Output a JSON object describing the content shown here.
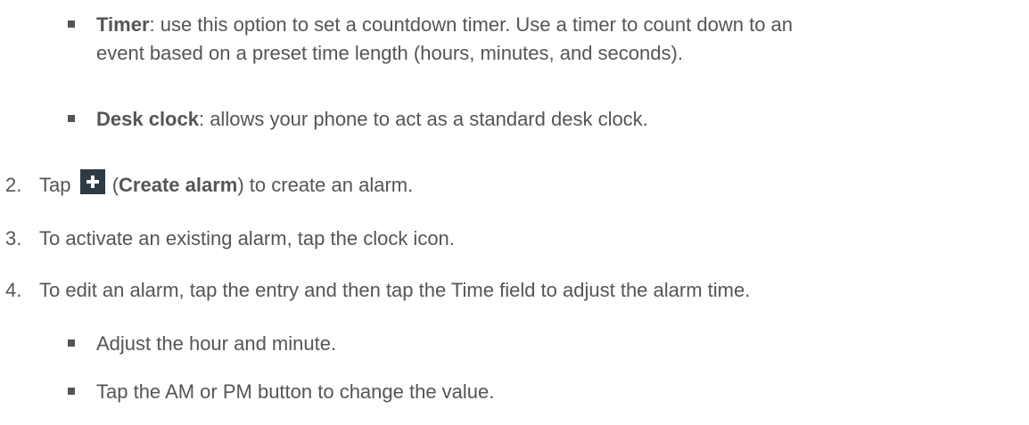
{
  "bullets_top": [
    {
      "term": "Timer",
      "line1": ": use this option to set a countdown timer. Use a timer to count down to an",
      "line2": "event based on a preset time length (hours, minutes, and seconds)."
    },
    {
      "term": "Desk clock",
      "line1": ": allows your phone to act as a standard desk clock."
    }
  ],
  "steps": [
    {
      "number": "2.",
      "before": "Tap ",
      "icon": "plus-icon",
      "open_paren": " (",
      "bold": "Create alarm",
      "after": ") to create an alarm."
    },
    {
      "number": "3.",
      "text": "To activate an existing alarm, tap the clock icon."
    },
    {
      "number": "4.",
      "text": "To edit an alarm, tap the entry and then tap the Time field to adjust the alarm time."
    }
  ],
  "bullets_bottom": [
    {
      "text": "Adjust the hour and minute."
    },
    {
      "text": "Tap the AM or PM button to change the value."
    }
  ]
}
